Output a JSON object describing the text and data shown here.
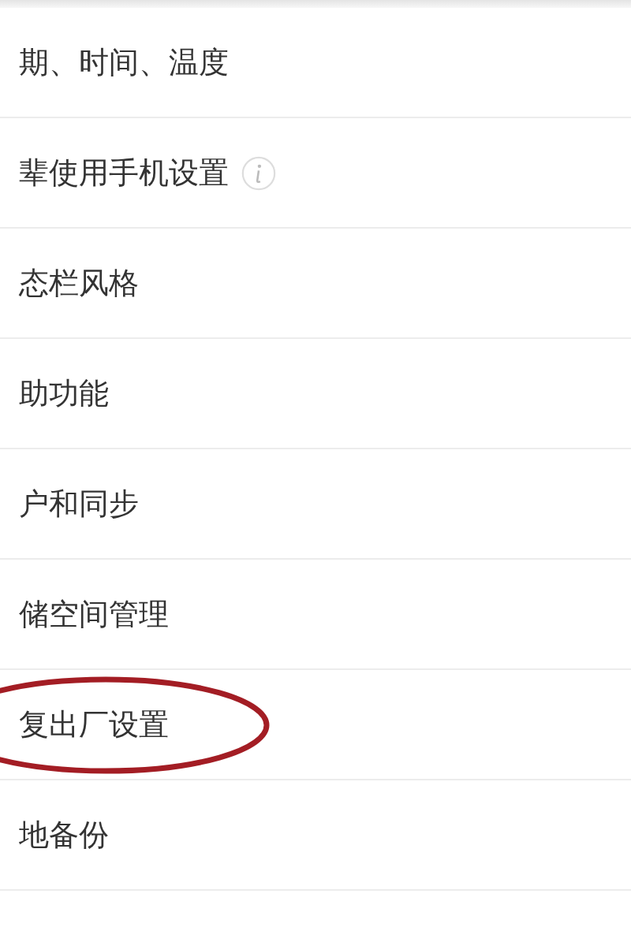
{
  "settings_list": [
    {
      "label": "期、时间、温度",
      "info": false,
      "circled": false
    },
    {
      "label": "辈使用手机设置",
      "info": true,
      "circled": false
    },
    {
      "label": "态栏风格",
      "info": false,
      "circled": false
    },
    {
      "label": "助功能",
      "info": false,
      "circled": false
    },
    {
      "label": "户和同步",
      "info": false,
      "circled": false
    },
    {
      "label": "储空间管理",
      "info": false,
      "circled": false
    },
    {
      "label": "复出厂设置",
      "info": false,
      "circled": true
    },
    {
      "label": "地备份",
      "info": false,
      "circled": false
    }
  ]
}
